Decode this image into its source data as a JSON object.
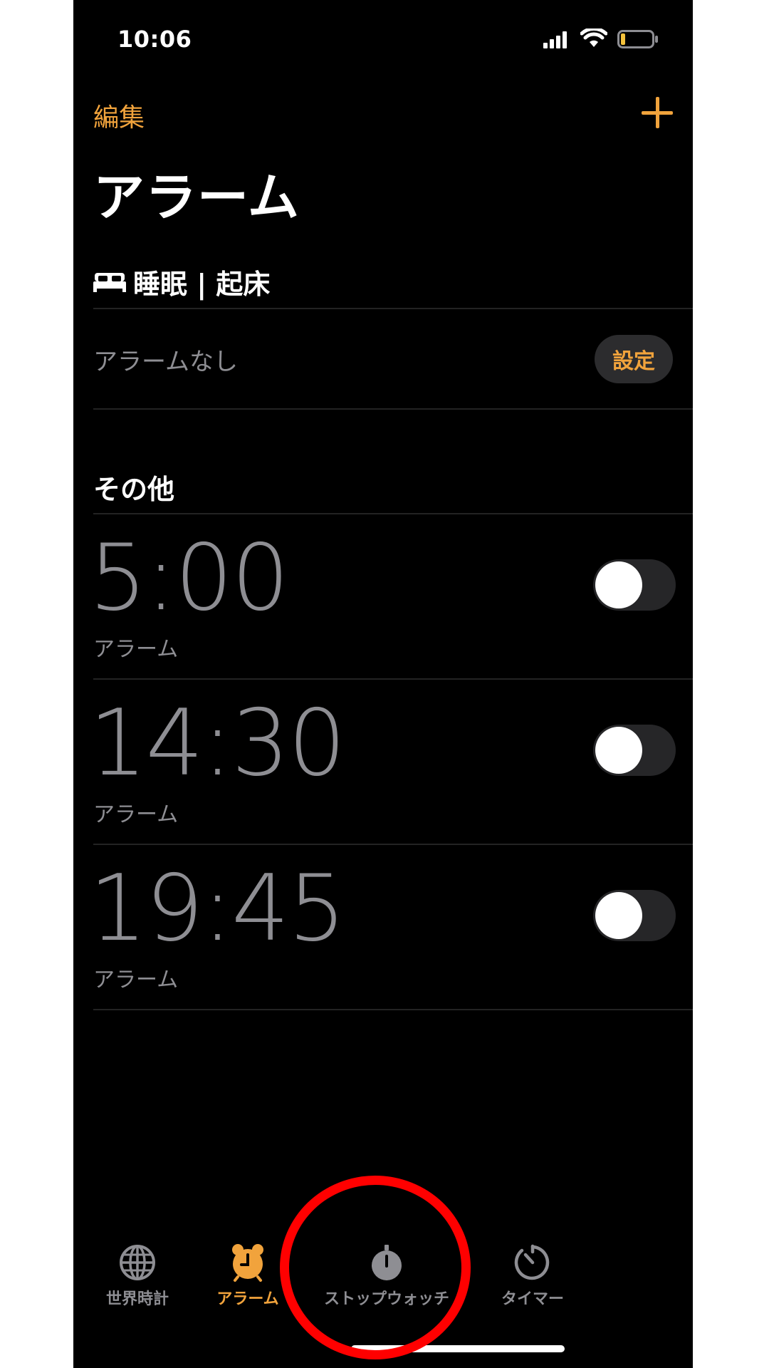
{
  "status_bar": {
    "time": "10:06"
  },
  "nav": {
    "edit_label": "編集",
    "add_label": "+"
  },
  "title": "アラーム",
  "sleep_section": {
    "header": "睡眠 | 起床",
    "empty_text": "アラームなし",
    "setup_label": "設定"
  },
  "other_section": {
    "header": "その他"
  },
  "alarms": [
    {
      "time": "5:00",
      "label": "アラーム",
      "enabled": false
    },
    {
      "time": "14:30",
      "label": "アラーム",
      "enabled": false
    },
    {
      "time": "19:45",
      "label": "アラーム",
      "enabled": false
    }
  ],
  "tab_bar": {
    "tabs": [
      {
        "label": "世界時計",
        "icon": "globe-icon",
        "active": false
      },
      {
        "label": "アラーム",
        "icon": "alarm-clock-icon",
        "active": true
      },
      {
        "label": "ストップウォッチ",
        "icon": "stopwatch-icon",
        "active": false
      },
      {
        "label": "タイマー",
        "icon": "timer-icon",
        "active": false
      }
    ]
  },
  "colors": {
    "accent": "#f1a33c",
    "background": "#000000",
    "secondary_text": "#8e8e93",
    "inactive_tab": "#8e8e93",
    "annotation": "#ff0000"
  }
}
